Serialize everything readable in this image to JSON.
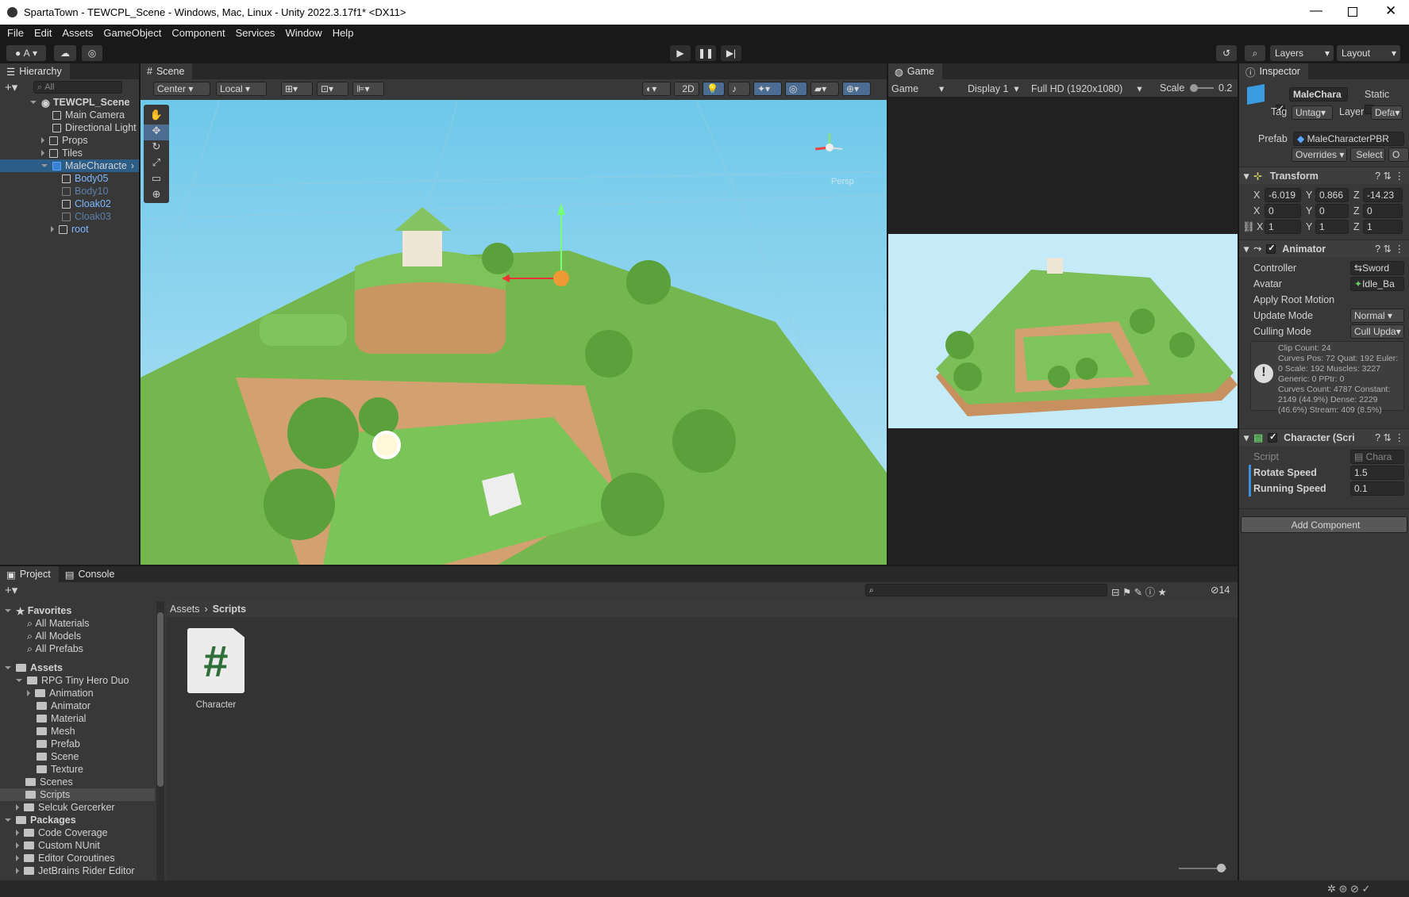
{
  "window": {
    "title": "SpartaTown - TEWCPL_Scene - Windows, Mac, Linux - Unity 2022.3.17f1* <DX11>"
  },
  "menu": [
    "File",
    "Edit",
    "Assets",
    "GameObject",
    "Component",
    "Services",
    "Window",
    "Help"
  ],
  "toolbar": {
    "account": "A",
    "layers": "Layers",
    "layout": "Layout"
  },
  "hierarchy": {
    "tab": "Hierarchy",
    "search_placeholder": "All",
    "scene": "TEWCPL_Scene",
    "items": [
      "Main Camera",
      "Directional Light",
      "Props",
      "Tiles",
      "MaleCharacte",
      "Body05",
      "Body10",
      "Cloak02",
      "Cloak03",
      "root"
    ]
  },
  "scene": {
    "tab": "Scene",
    "pivot": "Center",
    "space": "Local",
    "mode2d": "2D",
    "persp": "Persp"
  },
  "game": {
    "tab": "Game",
    "view": "Game",
    "display": "Display 1",
    "resolution": "Full HD (1920x1080)",
    "scale_label": "Scale",
    "scale_value": "0.2"
  },
  "inspector": {
    "tab": "Inspector",
    "name": "MaleChara",
    "static": "Static",
    "tag_label": "Tag",
    "tag": "Untag",
    "layer_label": "Layer",
    "layer": "Defa",
    "prefab_label": "Prefab",
    "prefab": "MaleCharacterPBR",
    "overrides": "Overrides",
    "select": "Select",
    "open": "O",
    "transform": {
      "title": "Transform",
      "x1": "-6.019",
      "y1": "0.866",
      "z1": "-14.23",
      "x2": "0",
      "y2": "0",
      "z2": "0",
      "x3": "1",
      "y3": "1",
      "z3": "1",
      "X": "X",
      "Y": "Y",
      "Z": "Z"
    },
    "animator": {
      "title": "Animator",
      "controller_label": "Controller",
      "controller": "Sword",
      "avatar_label": "Avatar",
      "avatar": "Idle_Ba",
      "root_label": "Apply Root Motion",
      "update_label": "Update Mode",
      "update": "Normal",
      "culling_label": "Culling Mode",
      "culling": "Cull Upda",
      "info": "Clip Count: 24\nCurves Pos: 72 Quat: 192 Euler: 0 Scale: 192 Muscles: 3227 Generic: 0 PPtr: 0\nCurves Count: 4787 Constant: 2149 (44.9%) Dense: 2229 (46.6%) Stream: 409 (8.5%)"
    },
    "character": {
      "title": "Character (Scri",
      "script_label": "Script",
      "script": "Chara",
      "rotate_label": "Rotate Speed",
      "rotate": "1.5",
      "running_label": "Running Speed",
      "running": "0.1"
    },
    "add_component": "Add Component"
  },
  "project": {
    "tab": "Project",
    "console_tab": "Console",
    "count": "14",
    "breadcrumb_root": "Assets",
    "breadcrumb_current": "Scripts",
    "asset": "Character",
    "favorites": "Favorites",
    "fav_items": [
      "All Materials",
      "All Models",
      "All Prefabs"
    ],
    "assets": "Assets",
    "rpg": "RPG Tiny Hero Duo",
    "rpg_items": [
      "Animation",
      "Animator",
      "Material",
      "Mesh",
      "Prefab",
      "Scene",
      "Texture"
    ],
    "asset_items": [
      "Scenes",
      "Scripts",
      "Selcuk Gercerker"
    ],
    "packages": "Packages",
    "package_items": [
      "Code Coverage",
      "Custom NUnit",
      "Editor Coroutines",
      "JetBrains Rider Editor"
    ]
  }
}
